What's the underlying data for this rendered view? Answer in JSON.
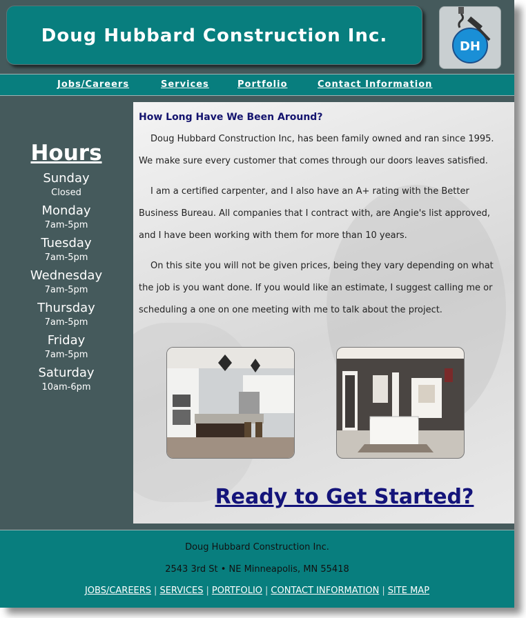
{
  "header": {
    "title": "Doug Hubbard Construction Inc.",
    "logo_text": "DH"
  },
  "nav": [
    {
      "label": "Jobs/Careers"
    },
    {
      "label": "Services"
    },
    {
      "label": "Portfolio"
    },
    {
      "label": "Contact Information"
    }
  ],
  "sidebar": {
    "title": "Hours",
    "schedule": [
      {
        "day": "Sunday",
        "time": "Closed"
      },
      {
        "day": "Monday",
        "time": "7am-5pm"
      },
      {
        "day": "Tuesday",
        "time": "7am-5pm"
      },
      {
        "day": "Wednesday",
        "time": "7am-5pm"
      },
      {
        "day": "Thursday",
        "time": "7am-5pm"
      },
      {
        "day": "Friday",
        "time": "7am-5pm"
      },
      {
        "day": "Saturday",
        "time": "10am-6pm"
      }
    ]
  },
  "main": {
    "heading": "How Long Have We Been Around?",
    "paragraphs": [
      "Doug Hubbard Construction Inc, has been family owned and ran since 1995. We make sure every customer that comes through our doors leaves satisfied.",
      "I am a certified carpenter, and I also have an A+ rating with the Better Business Bureau. All companies that I contract with, are Angie's list approved, and I have been working with them for more than 10 years.",
      "On this site you will not be given prices, being they vary depending on what the job is you want done. If you would like an estimate, I suggest calling me or scheduling a one on one meeting with me to talk about the project."
    ],
    "cta": "Ready to Get Started?"
  },
  "footer": {
    "company": "Doug Hubbard Construction Inc.",
    "address": "2543 3rd St • NE Minneapolis, MN 55418",
    "links": [
      {
        "label": "JOBS/CAREERS"
      },
      {
        "label": "SERVICES"
      },
      {
        "label": "PORTFOLIO"
      },
      {
        "label": "CONTACT INFORMATION"
      },
      {
        "label": "SITE MAP"
      }
    ],
    "separator": "|"
  },
  "colors": {
    "teal": "#087e7e",
    "slate": "#455a5c",
    "heading_navy": "#14146e"
  }
}
